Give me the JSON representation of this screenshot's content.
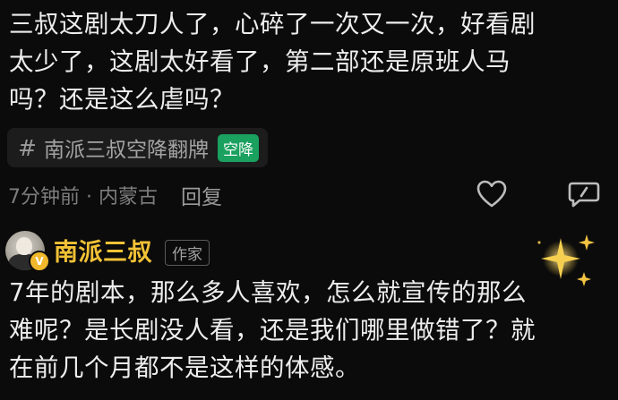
{
  "comment": {
    "lines": [
      "三叔这剧太刀人了，心碎了一次又一次，好看剧",
      "太少了，这剧太好看了，第二部还是原班人马",
      "吗？还是这么虐吗？"
    ],
    "topic": {
      "hash": "#",
      "text": "南派三叔空降翻牌",
      "badge": "空降",
      "badge_color": "#1aa05f"
    },
    "meta": {
      "time_location": "7分钟前 · 内蒙古",
      "reply_label": "回复"
    },
    "icons": [
      "heart-icon",
      "dislike-icon"
    ]
  },
  "reply": {
    "author": "南派三叔",
    "author_color": "#f2c236",
    "tag": "作家",
    "verified_icon": "v-badge-icon",
    "lines": [
      "7年的剧本，那么多人喜欢，怎么就宣传的那么",
      "难呢？是长剧没人看，还是我们哪里做错了？就",
      "在前几个月都不是这样的体感。"
    ]
  }
}
